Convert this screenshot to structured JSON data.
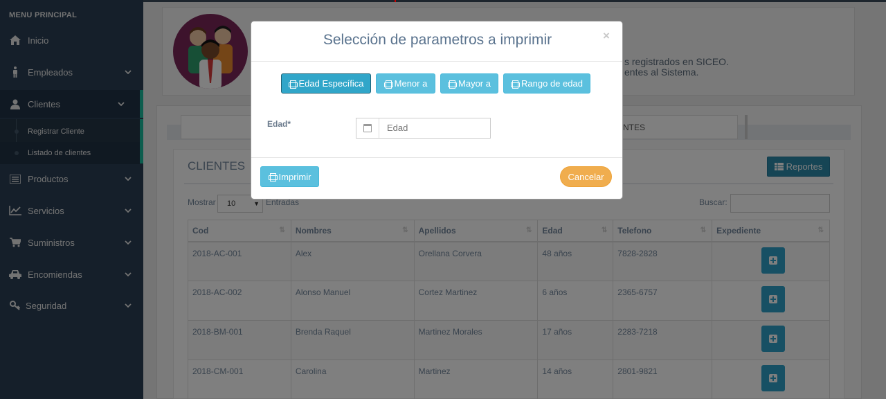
{
  "sidebar": {
    "menu_title": "MENU PRINCIPAL",
    "items": [
      {
        "label": "Inicio",
        "icon": "home-icon"
      },
      {
        "label": "Empleados",
        "icon": "male-icon"
      },
      {
        "label": "Clientes",
        "icon": "user-icon"
      },
      {
        "label": "Productos",
        "icon": "list-icon"
      },
      {
        "label": "Servicios",
        "icon": "chart-icon"
      },
      {
        "label": "Suministros",
        "icon": "cart-icon"
      },
      {
        "label": "Encomiendas",
        "icon": "car-icon"
      },
      {
        "label": "Seguridad",
        "icon": "key-icon"
      }
    ],
    "clientes_sub": [
      "Registrar Cliente",
      "Listado de clientes"
    ]
  },
  "background": {
    "info_line1": "s registrados en SICEO.",
    "info_line2": "entes al Sistema.",
    "tab_label": "NTES",
    "clientes_title": "CLIENTES",
    "reportes_label": "Reportes",
    "mostrar": "Mostrar",
    "page_len": "10",
    "entradas": "Entradas",
    "buscar": "Buscar:",
    "columns": [
      "Cod",
      "Nombres",
      "Apellidos",
      "Edad",
      "Telefono",
      "Expediente"
    ],
    "rows": [
      {
        "cod": "2018-AC-001",
        "nombres": "Alex",
        "apellidos": "Orellana Corvera",
        "edad": "48 años",
        "telefono": "7828-2828"
      },
      {
        "cod": "2018-AC-002",
        "nombres": "Alonso Manuel",
        "apellidos": "Cortez Martinez",
        "edad": "6 años",
        "telefono": "2365-6757"
      },
      {
        "cod": "2018-BM-001",
        "nombres": "Brenda Raquel",
        "apellidos": "Martinez Morales",
        "edad": "17 años",
        "telefono": "2283-7218"
      },
      {
        "cod": "2018-CM-001",
        "nombres": "Carolina",
        "apellidos": "Martinez",
        "edad": "14 años",
        "telefono": "2801-9821"
      }
    ]
  },
  "modal": {
    "title": "Selección de parametros a imprimir",
    "close": "×",
    "options": [
      "Edad Específica",
      "Menor a",
      "Mayor a",
      "Rango de edad"
    ],
    "selected_option": "Edad Específica",
    "field_label": "Edad*",
    "field_placeholder": "Edad",
    "print_label": "Imprimir",
    "cancel_label": "Cancelar"
  },
  "colors": {
    "sidebar_bg": "#2a3f54",
    "accent_green": "#1abb9c",
    "info_button": "#5bc0de",
    "warning_button": "#f0ad4e"
  }
}
